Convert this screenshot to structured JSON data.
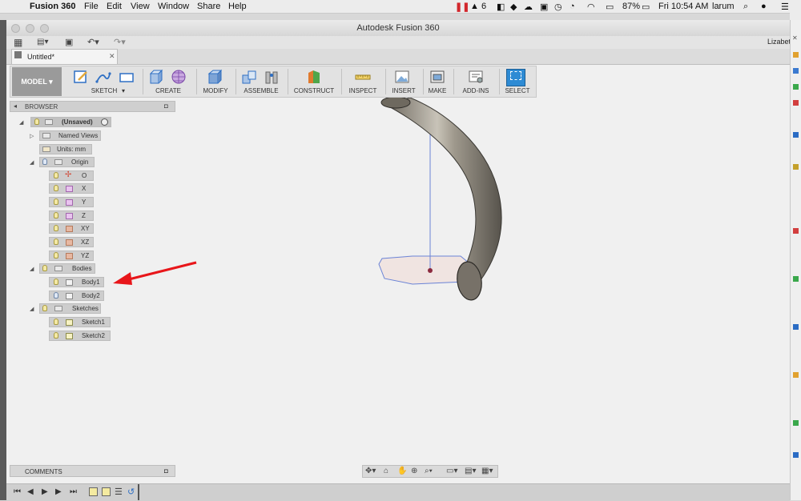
{
  "menubar": {
    "app_name": "Fusion 360",
    "menus": [
      "File",
      "Edit",
      "View",
      "Window",
      "Share",
      "Help"
    ],
    "badge_count": "6",
    "battery": "87%",
    "clock": "Fri 10:54 AM",
    "user": "larum"
  },
  "window": {
    "title": "Autodesk Fusion 360",
    "user_label": "Lizabet",
    "doc_tab": "Untitled*"
  },
  "toolbar": {
    "mode": "MODEL",
    "groups": [
      "SKETCH",
      "CREATE",
      "MODIFY",
      "ASSEMBLE",
      "CONSTRUCT",
      "INSPECT",
      "INSERT",
      "MAKE",
      "ADD-INS",
      "SELECT"
    ]
  },
  "browser": {
    "header": "BROWSER",
    "root": "(Unsaved)",
    "named_views": "Named Views",
    "units": "Units: mm",
    "origin": "Origin",
    "origin_items": [
      "O",
      "X",
      "Y",
      "Z",
      "XY",
      "XZ",
      "YZ"
    ],
    "bodies": "Bodies",
    "body_items": [
      "Body1",
      "Body2"
    ],
    "sketches": "Sketches",
    "sketch_items": [
      "Sketch1",
      "Sketch2"
    ]
  },
  "comments": {
    "label": "COMMENTS"
  },
  "colors": {
    "annotation_arrow": "#e8161a",
    "sketch_line": "#6a83d6",
    "body_metal": "#8d877c",
    "select_accent": "#2e8bd4"
  }
}
